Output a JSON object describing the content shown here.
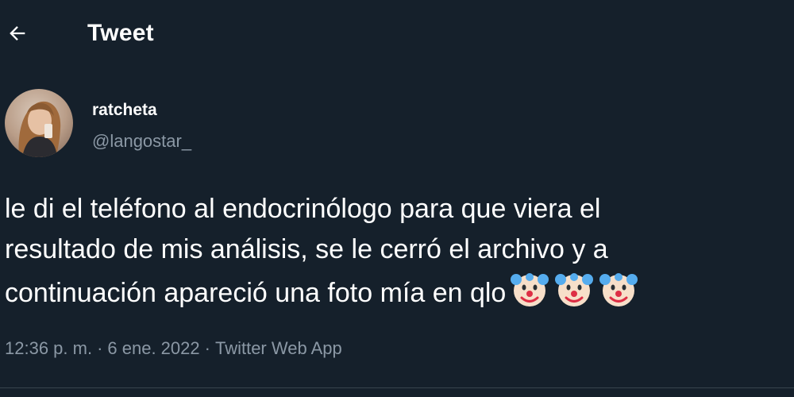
{
  "header": {
    "title": "Tweet",
    "back_icon": "arrow-left-icon"
  },
  "author": {
    "display_name": "ratcheta",
    "handle": "@langostar_"
  },
  "tweet": {
    "lines": [
      "le di el teléfono al endocrinólogo para que viera el",
      "resultado de mis análisis, se le cerró el archivo y a",
      "continuación apareció una foto mía en qlo"
    ],
    "emojis": [
      "clown-face-icon",
      "clown-face-icon",
      "clown-face-icon"
    ]
  },
  "meta": {
    "time": "12:36 p. m.",
    "separator": "·",
    "date": "6 ene. 2022",
    "source": "Twitter Web App"
  },
  "colors": {
    "background": "#15202b",
    "primary_text": "#ffffff",
    "secondary_text": "#8b98a5",
    "divider": "#38444d"
  }
}
